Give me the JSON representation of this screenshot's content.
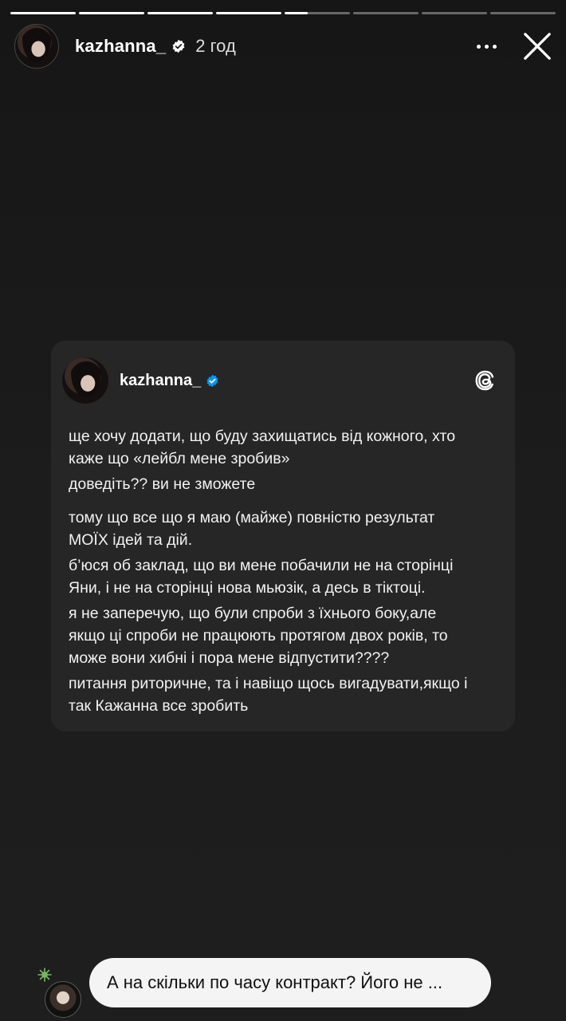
{
  "story": {
    "segments": [
      {
        "progress": 1.0
      },
      {
        "progress": 1.0
      },
      {
        "progress": 1.0
      },
      {
        "progress": 1.0
      },
      {
        "progress": 0.35
      },
      {
        "progress": 0.0
      },
      {
        "progress": 0.0
      },
      {
        "progress": 0.0
      }
    ],
    "username": "kazhanna_",
    "time": "2 год"
  },
  "card": {
    "username": "kazhanna_",
    "paragraphs": [
      {
        "text": "ще хочу додати, що буду захищатись від кожного, хто\nкаже що «лейбл мене зробив»",
        "gap": false
      },
      {
        "text": "доведіть?? ви не зможете",
        "gap": false
      },
      {
        "text": "тому що все що я маю (майже) повністю результат\nМОЇХ ідей та дій.",
        "gap": true
      },
      {
        "text": "б’юся об заклад, що ви мене побачили не на сторінці\nЯни, і не на сторінці нова мьюзік, а десь в тіктоці.",
        "gap": false
      },
      {
        "text": "я не заперечую, що були спроби з їхнього боку,але\nякщо ці спроби не працюють протягом двох років, то\nможе вони хибні і пора мене відпустити????",
        "gap": false
      },
      {
        "text": "питання риторичне, та і навіщо щось вигадувати,якщо і\nтак Кажанна все зробить",
        "gap": false
      }
    ]
  },
  "reply": {
    "text": "А на скільки по часу контракт? Його не ..."
  },
  "colors": {
    "verified_blue": "#0095f6",
    "card_bg": "#262626",
    "bubble_bg": "#f4f4f4",
    "sparkle_green": "#7bb661"
  },
  "icons": {
    "verified": "verified-badge-icon",
    "more": "more-horizontal-icon",
    "close": "close-icon",
    "threads": "threads-logo-icon",
    "sparkle": "sparkle-icon"
  }
}
